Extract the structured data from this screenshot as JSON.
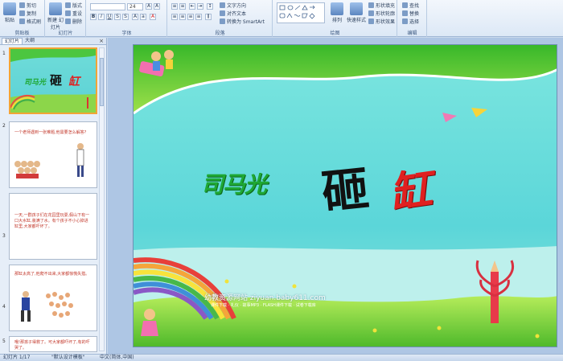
{
  "ribbon": {
    "clipboard": {
      "label": "剪贴板",
      "paste": "粘贴",
      "cut": "剪切",
      "copy": "复制",
      "format_painter": "格式刷"
    },
    "slides": {
      "label": "幻灯片",
      "new_slide": "新建\n幻灯片",
      "layout": "版式",
      "reset": "重设",
      "delete": "删除"
    },
    "font": {
      "label": "字体",
      "font_size": "24"
    },
    "paragraph": {
      "label": "段落",
      "text_direction": "文字方向",
      "align_text": "对齐文本",
      "smartart": "转换为 SmartArt"
    },
    "drawing": {
      "label": "绘图",
      "arrange": "排列",
      "quick_styles": "快速样式",
      "shape_fill": "形状填充",
      "shape_outline": "形状轮廓",
      "shape_effects": "形状效果"
    },
    "editing": {
      "label": "编辑",
      "find": "查找",
      "replace": "替换",
      "select": "选择"
    }
  },
  "panel": {
    "tab_slides": "幻灯片",
    "tab_outline": "大纲",
    "close": "×",
    "thumbs": [
      {
        "num": "1",
        "title_a": "司马光",
        "title_b": "砸",
        "title_c": "缸"
      },
      {
        "num": "2",
        "text": "一个老师遇到一张难题,他需要怎么解答?"
      },
      {
        "num": "3",
        "text": "一天,一群孩子们在花园里玩耍,假山下有一口大水缸,装满了水。有个孩子不小心掉进缸里,大家都吓坏了。"
      },
      {
        "num": "4",
        "text": "那缸太高了,他爬不出来,大家都惊慌失措。"
      },
      {
        "num": "5",
        "text": "哦!那孩子得救了。可大家都吓坏了,有的吓哭了。"
      }
    ]
  },
  "slide": {
    "word1": "司马光",
    "word2": "砸",
    "word3": "缸",
    "watermark": "幼教资源网站  ziyuan.baby611.com",
    "watermark_sub": "课件下载 · 礼仪 · 故事MP3 · FLASH课件下载 · 试卷下载库"
  },
  "status": {
    "slide_info": "幻灯片 1/17",
    "theme": "\"默认设计模板\"",
    "language": "中文(简体,中国)"
  },
  "colors": {
    "title_green": "#1fa834",
    "char_black": "#111111",
    "char_red": "#e02020",
    "selection": "#f2a435"
  }
}
